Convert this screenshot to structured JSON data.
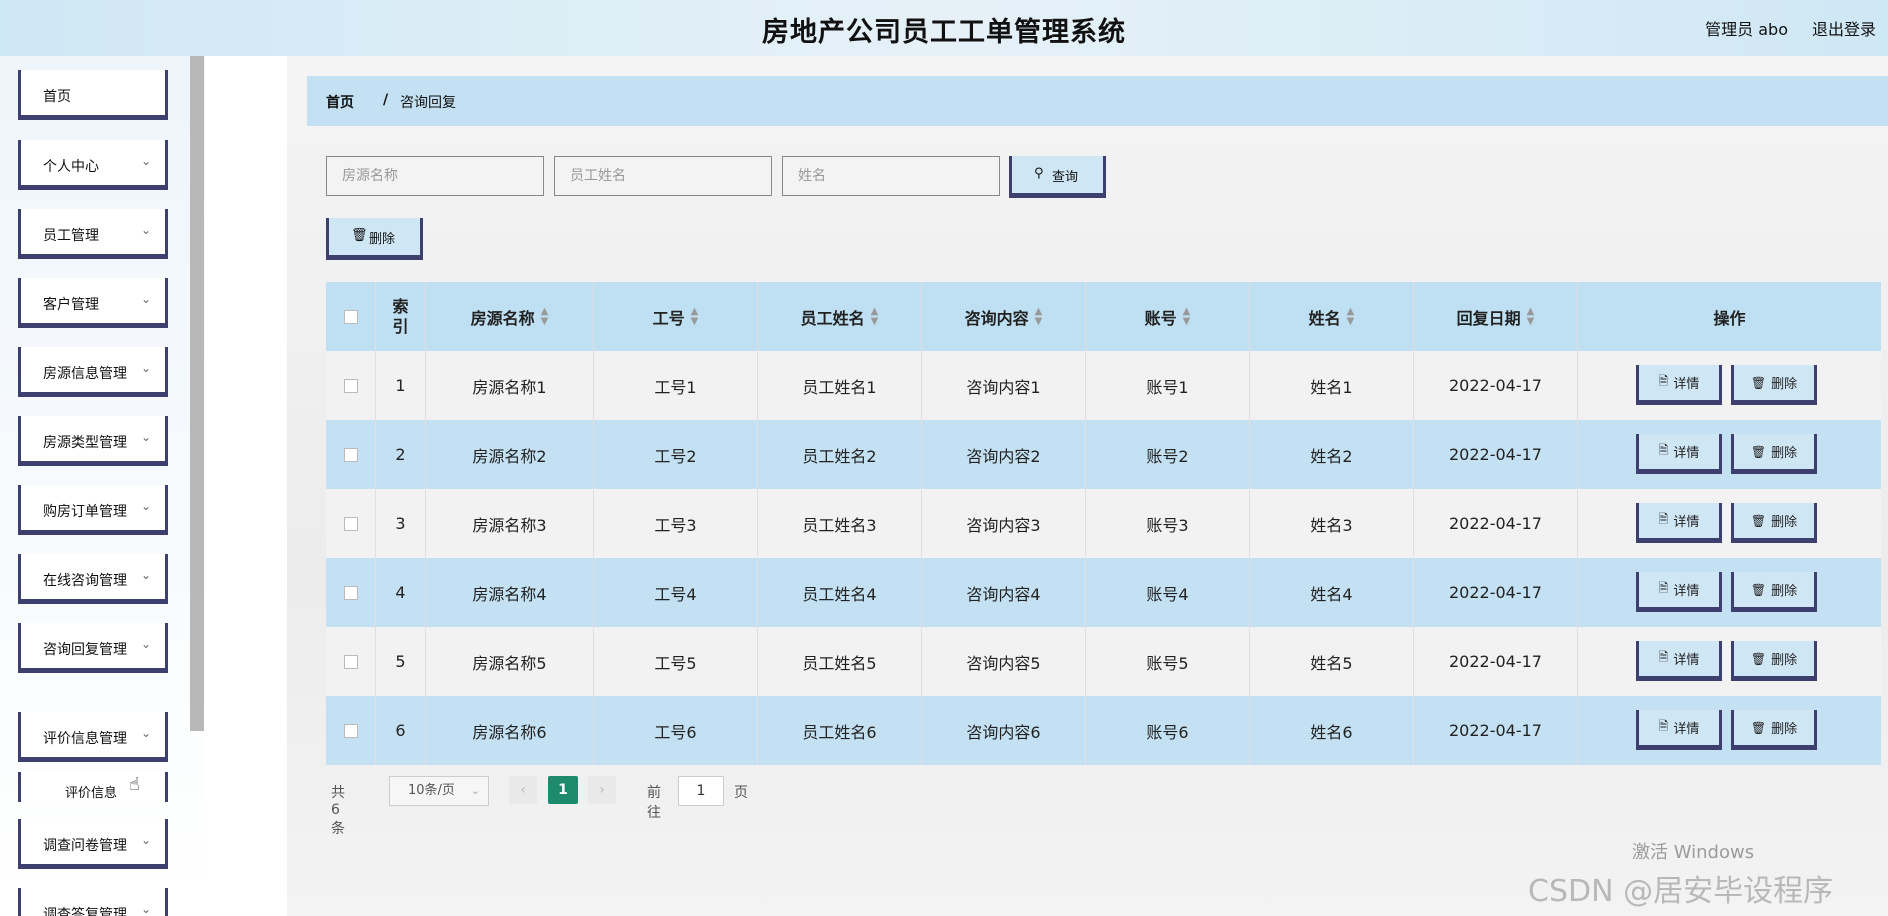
{
  "header": {
    "title": "房地产公司员工工单管理系统",
    "user": "管理员 abo",
    "logout": "退出登录"
  },
  "sidebar": {
    "items": [
      {
        "label": "首页",
        "has_chevron": false
      },
      {
        "label": "个人中心",
        "has_chevron": true
      },
      {
        "label": "员工管理",
        "has_chevron": true
      },
      {
        "label": "客户管理",
        "has_chevron": true
      },
      {
        "label": "房源信息管理",
        "has_chevron": true
      },
      {
        "label": "房源类型管理",
        "has_chevron": true
      },
      {
        "label": "购房订单管理",
        "has_chevron": true
      },
      {
        "label": "在线咨询管理",
        "has_chevron": true
      },
      {
        "label": "咨询回复管理",
        "has_chevron": true
      },
      {
        "label": "评价信息管理",
        "has_chevron": true
      },
      {
        "label": "调查问卷管理",
        "has_chevron": true
      },
      {
        "label": "调查答复管理",
        "has_chevron": true
      }
    ],
    "submenu": {
      "label": "评价信息"
    }
  },
  "breadcrumb": {
    "home": "首页",
    "separator": "/",
    "current": "咨询回复"
  },
  "search": {
    "field1_placeholder": "房源名称",
    "field2_placeholder": "员工姓名",
    "field3_placeholder": "姓名",
    "query_button": "查询"
  },
  "toolbar": {
    "delete_button": "删除"
  },
  "table": {
    "columns": [
      "索引",
      "房源名称",
      "工号",
      "员工姓名",
      "咨询内容",
      "账号",
      "姓名",
      "回复日期",
      "操作"
    ],
    "rows": [
      {
        "index": "1",
        "house": "房源名称1",
        "emp_no": "工号1",
        "emp_name": "员工姓名1",
        "content": "咨询内容1",
        "account": "账号1",
        "name": "姓名1",
        "date": "2022-04-17"
      },
      {
        "index": "2",
        "house": "房源名称2",
        "emp_no": "工号2",
        "emp_name": "员工姓名2",
        "content": "咨询内容2",
        "account": "账号2",
        "name": "姓名2",
        "date": "2022-04-17"
      },
      {
        "index": "3",
        "house": "房源名称3",
        "emp_no": "工号3",
        "emp_name": "员工姓名3",
        "content": "咨询内容3",
        "account": "账号3",
        "name": "姓名3",
        "date": "2022-04-17"
      },
      {
        "index": "4",
        "house": "房源名称4",
        "emp_no": "工号4",
        "emp_name": "员工姓名4",
        "content": "咨询内容4",
        "account": "账号4",
        "name": "姓名4",
        "date": "2022-04-17"
      },
      {
        "index": "5",
        "house": "房源名称5",
        "emp_no": "工号5",
        "emp_name": "员工姓名5",
        "content": "咨询内容5",
        "account": "账号5",
        "name": "姓名5",
        "date": "2022-04-17"
      },
      {
        "index": "6",
        "house": "房源名称6",
        "emp_no": "工号6",
        "emp_name": "员工姓名6",
        "content": "咨询内容6",
        "account": "账号6",
        "name": "姓名6",
        "date": "2022-04-17"
      }
    ],
    "detail_button": "详情",
    "row_delete_button": "删除"
  },
  "pagination": {
    "total": "共 6 条",
    "page_size": "10条/页",
    "current_page": "1",
    "goto_label": "前往",
    "goto_value": "1",
    "page_suffix": "页"
  },
  "watermarks": {
    "windows": "激活 Windows",
    "csdn": "CSDN @居安毕设程序"
  },
  "colors": {
    "header_bg": "#cfe8f5",
    "accent_dark": "#3d3f6e",
    "row_blue": "#c3e1f3",
    "row_gray": "#f2f2f2",
    "page_active": "#1e8b6f"
  }
}
